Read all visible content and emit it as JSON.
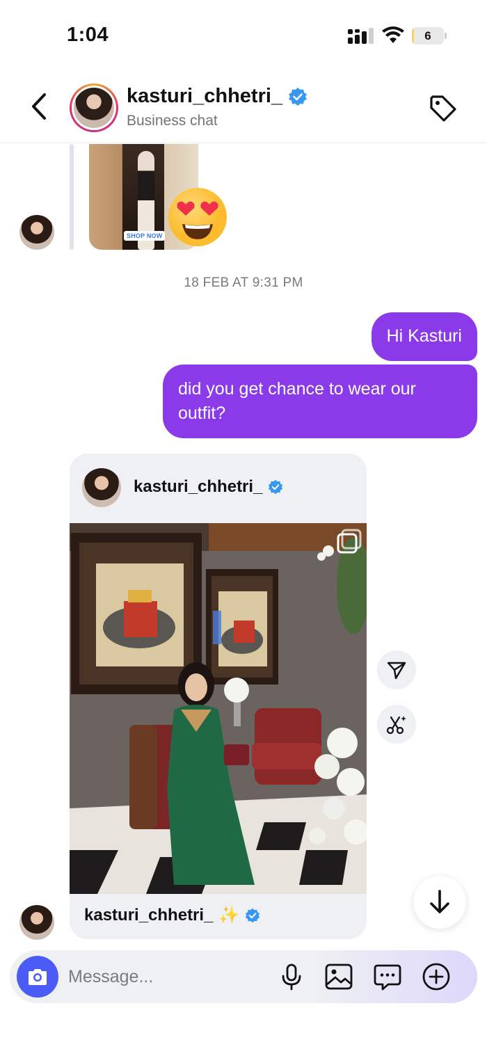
{
  "status_bar": {
    "time": "1:04",
    "battery_level": "6",
    "battery_fraction": 0.06,
    "battery_color": "#f3d36b"
  },
  "header": {
    "username": "kasturi_chhetri_",
    "subtitle": "Business chat",
    "icons": [
      "chevron-left-icon",
      "verified-icon",
      "tag-icon"
    ]
  },
  "story_reply": {
    "badge": "SHOP NOW",
    "reaction": "😍"
  },
  "timestamp": "18 FEB AT 9:31 PM",
  "messages": [
    {
      "from": "me",
      "text": "Hi Kasturi"
    },
    {
      "from": "me",
      "text": "did you get chance to wear our outfit?"
    }
  ],
  "shared_post": {
    "username": "kasturi_chhetri_",
    "caption_username": "kasturi_chhetri_",
    "caption_emoji": "✨"
  },
  "side_actions": [
    "send-icon",
    "magic-cut-icon"
  ],
  "composer": {
    "placeholder": "Message...",
    "icons": [
      "camera-icon",
      "microphone-icon",
      "gallery-icon",
      "sticker-chat-icon",
      "plus-circle-icon"
    ]
  },
  "colors": {
    "outgoing_bubble": "#8a3ae8",
    "camera_button": "#4a5cf5",
    "verified": "#3897f0"
  }
}
